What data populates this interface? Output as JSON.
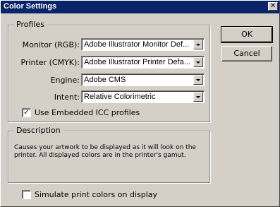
{
  "window": {
    "title": "Color Settings",
    "close_glyph": "✕"
  },
  "profiles": {
    "group_label": "Profiles",
    "monitor": {
      "label": "Monitor (RGB):",
      "value": "Adobe Illustrator Monitor Def..."
    },
    "printer": {
      "label": "Printer (CMYK):",
      "value": "Adobe Illustrator Printer Defa..."
    },
    "engine": {
      "label": "Engine:",
      "value": "Adobe CMS"
    },
    "intent": {
      "label": "Intent:",
      "value": "Relative Colorimetric"
    },
    "use_icc": {
      "label": "Use Embedded ICC profiles",
      "checked": true,
      "check_glyph": "✓"
    }
  },
  "description": {
    "group_label": "Description",
    "text": "Causes your artwork to be displayed as it will look on the printer. All displayed colors are in the printer's gamut."
  },
  "simulate": {
    "label": "Simulate print colors on display",
    "checked": false
  },
  "buttons": {
    "ok": "OK",
    "cancel": "Cancel"
  },
  "icons": {
    "close": "close-icon",
    "dropdown": "chevron-down-icon",
    "check": "checkmark-icon"
  },
  "colors": {
    "titlebar": "#0a246a",
    "face": "#d4d0c8"
  }
}
